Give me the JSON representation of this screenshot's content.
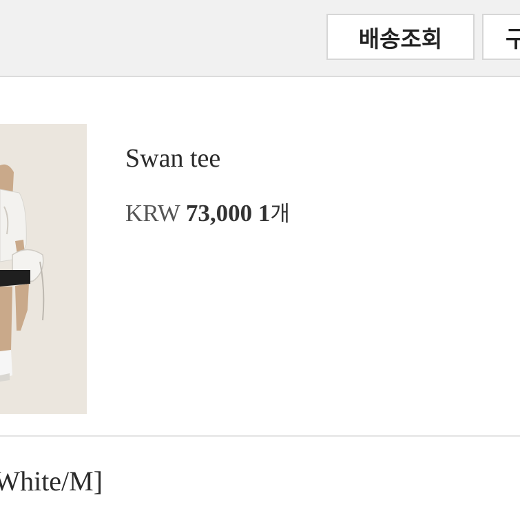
{
  "header": {
    "track_button_label": "배송조회",
    "buy_button_label": "구매"
  },
  "product": {
    "name": "Swan tee",
    "currency": "KRW",
    "price": "73,000",
    "quantity": "1",
    "quantity_unit": "개",
    "option": "[White/M]"
  },
  "colors": {
    "header_bg": "#f1f1f1",
    "thumb_bg": "#ebe6de",
    "text": "#2b2b2b"
  }
}
